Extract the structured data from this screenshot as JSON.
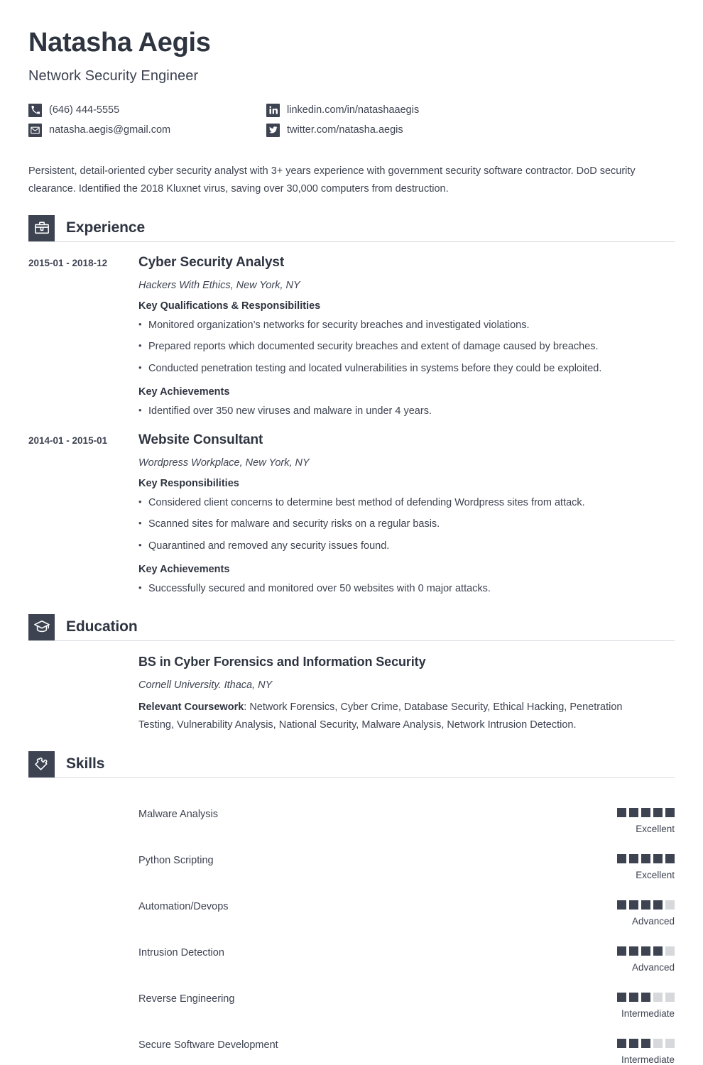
{
  "header": {
    "name": "Natasha Aegis",
    "job_title": "Network Security Engineer",
    "contacts": [
      {
        "icon": "phone-icon",
        "value": "(646) 444-5555"
      },
      {
        "icon": "linkedin-icon",
        "value": "linkedin.com/in/natashaaegis"
      },
      {
        "icon": "email-icon",
        "value": "natasha.aegis@gmail.com"
      },
      {
        "icon": "twitter-icon",
        "value": "twitter.com/natasha.aegis"
      }
    ]
  },
  "summary": "Persistent, detail-oriented cyber security analyst with 3+ years experience with government security software contractor. DoD security clearance. Identified the 2018 Kluxnet virus, saving over 30,000 computers from destruction.",
  "sections": {
    "experience": {
      "title": "Experience",
      "icon": "briefcase-icon",
      "entries": [
        {
          "dates": "2015-01 - 2018-12",
          "role": "Cyber Security Analyst",
          "company": "Hackers With Ethics, New York, NY",
          "groups": [
            {
              "heading": "Key Qualifications & Responsibilities",
              "bullets": [
                "Monitored organization’s networks for security breaches and investigated violations.",
                "Prepared reports which documented security breaches and extent of damage caused by breaches.",
                "Conducted penetration testing and located vulnerabilities in systems before they could be exploited."
              ]
            },
            {
              "heading": "Key Achievements",
              "bullets": [
                "Identified over 350 new viruses and malware in under 4 years."
              ]
            }
          ]
        },
        {
          "dates": "2014-01 - 2015-01",
          "role": "Website Consultant",
          "company": "Wordpress Workplace, New York, NY",
          "groups": [
            {
              "heading": "Key Responsibilities",
              "bullets": [
                "Considered client concerns to determine best method of defending Wordpress sites from attack.",
                "Scanned sites for malware and security risks on a regular basis.",
                "Quarantined and removed any security issues found."
              ]
            },
            {
              "heading": "Key Achievements",
              "bullets": [
                "Successfully secured and monitored over 50 websites with 0 major attacks."
              ]
            }
          ]
        }
      ]
    },
    "education": {
      "title": "Education",
      "icon": "graduation-cap-icon",
      "degree": "BS in Cyber Forensics and Information Security",
      "school": "Cornell University. Ithaca, NY",
      "coursework_label": "Relevant Coursework",
      "coursework_text": ": Network Forensics, Cyber Crime, Database Security, Ethical Hacking, Penetration Testing, Vulnerability Analysis, National Security, Malware Analysis, Network Intrusion Detection."
    },
    "skills": {
      "title": "Skills",
      "icon": "puzzle-piece-icon",
      "max_rating": 5,
      "items": [
        {
          "name": "Malware Analysis",
          "rating": 5,
          "level": "Excellent"
        },
        {
          "name": "Python Scripting",
          "rating": 5,
          "level": "Excellent"
        },
        {
          "name": "Automation/Devops",
          "rating": 4,
          "level": "Advanced"
        },
        {
          "name": "Intrusion Detection",
          "rating": 4,
          "level": "Advanced"
        },
        {
          "name": "Reverse Engineering",
          "rating": 3,
          "level": "Intermediate"
        },
        {
          "name": "Secure Software Development",
          "rating": 3,
          "level": "Intermediate"
        }
      ]
    }
  },
  "colors": {
    "ink": "#3d4351",
    "heading": "#2e3440",
    "rating_filled": "#3d4351",
    "rating_empty": "#d6d8db",
    "divider": "#d8dade"
  }
}
